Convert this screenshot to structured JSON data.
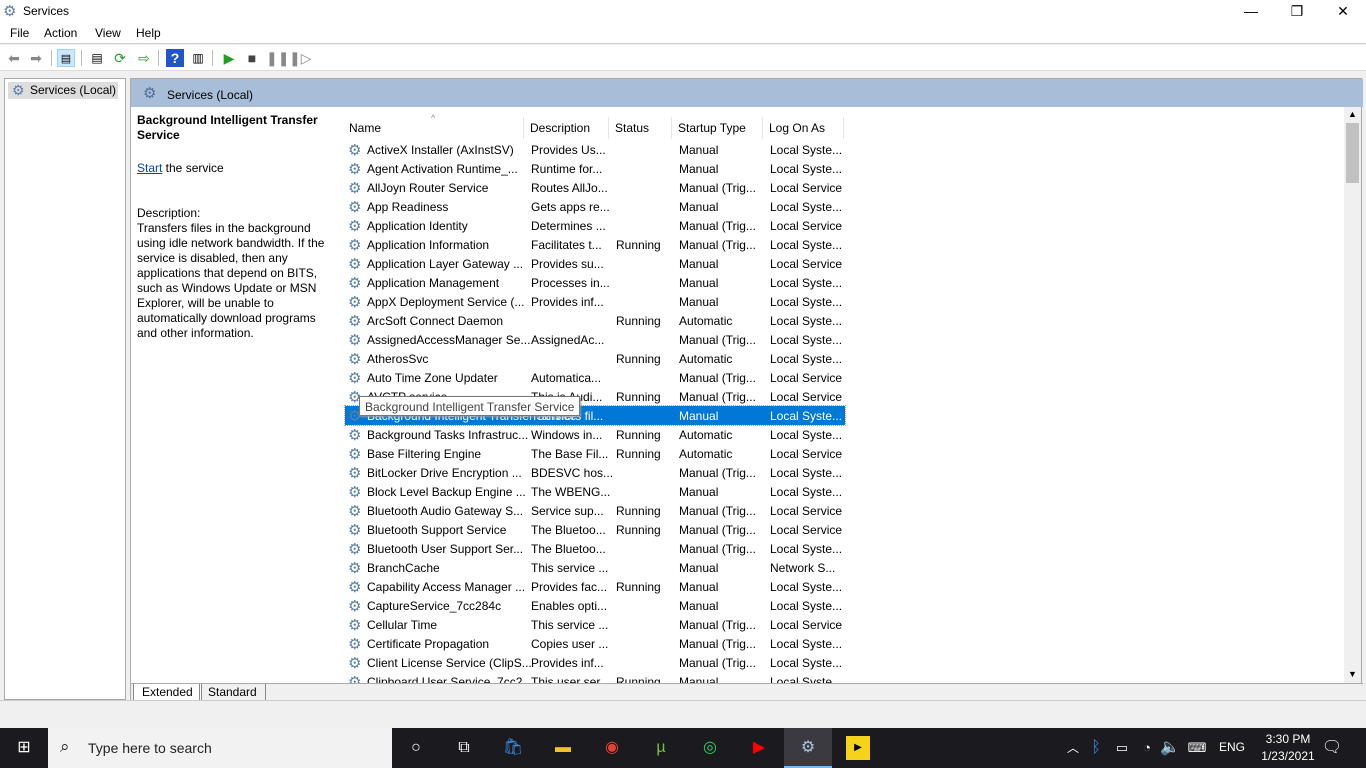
{
  "window": {
    "title": "Services",
    "minimize": "—",
    "restore": "❐",
    "close": "✕"
  },
  "menu": [
    "File",
    "Action",
    "View",
    "Help"
  ],
  "tree": {
    "item": "Services (Local)"
  },
  "header": {
    "title": "Services (Local)"
  },
  "details": {
    "service_name": "Background Intelligent Transfer Service",
    "start_link": "Start",
    "start_rest": " the service",
    "description_label": "Description:",
    "description": "Transfers files in the background using idle network bandwidth. If the service is disabled, then any applications that depend on BITS, such as Windows Update or MSN Explorer, will be unable to automatically download programs and other information."
  },
  "columns": [
    "Name",
    "Description",
    "Status",
    "Startup Type",
    "Log On As"
  ],
  "rows": [
    [
      "ActiveX Installer (AxInstSV)",
      "Provides Us...",
      "",
      "Manual",
      "Local Syste..."
    ],
    [
      "Agent Activation Runtime_...",
      "Runtime for...",
      "",
      "Manual",
      "Local Syste..."
    ],
    [
      "AllJoyn Router Service",
      "Routes AllJo...",
      "",
      "Manual (Trig...",
      "Local Service"
    ],
    [
      "App Readiness",
      "Gets apps re...",
      "",
      "Manual",
      "Local Syste..."
    ],
    [
      "Application Identity",
      "Determines ...",
      "",
      "Manual (Trig...",
      "Local Service"
    ],
    [
      "Application Information",
      "Facilitates t...",
      "Running",
      "Manual (Trig...",
      "Local Syste..."
    ],
    [
      "Application Layer Gateway ...",
      "Provides su...",
      "",
      "Manual",
      "Local Service"
    ],
    [
      "Application Management",
      "Processes in...",
      "",
      "Manual",
      "Local Syste..."
    ],
    [
      "AppX Deployment Service (...",
      "Provides inf...",
      "",
      "Manual",
      "Local Syste..."
    ],
    [
      "ArcSoft Connect Daemon",
      "",
      "Running",
      "Automatic",
      "Local Syste..."
    ],
    [
      "AssignedAccessManager Se...",
      "AssignedAc...",
      "",
      "Manual (Trig...",
      "Local Syste..."
    ],
    [
      "AtherosSvc",
      "",
      "Running",
      "Automatic",
      "Local Syste..."
    ],
    [
      "Auto Time Zone Updater",
      "Automatica...",
      "",
      "Manual (Trig...",
      "Local Service"
    ],
    [
      "AVCTP service",
      "This is Audi...",
      "Running",
      "Manual (Trig...",
      "Local Service"
    ],
    [
      "Background Intelligent Transfer Service",
      "Transfers fil...",
      "",
      "Manual",
      "Local Syste..."
    ],
    [
      "Background Tasks Infrastruc...",
      "Windows in...",
      "Running",
      "Automatic",
      "Local Syste..."
    ],
    [
      "Base Filtering Engine",
      "The Base Fil...",
      "Running",
      "Automatic",
      "Local Service"
    ],
    [
      "BitLocker Drive Encryption ...",
      "BDESVC hos...",
      "",
      "Manual (Trig...",
      "Local Syste..."
    ],
    [
      "Block Level Backup Engine ...",
      "The WBENG...",
      "",
      "Manual",
      "Local Syste..."
    ],
    [
      "Bluetooth Audio Gateway S...",
      "Service sup...",
      "Running",
      "Manual (Trig...",
      "Local Service"
    ],
    [
      "Bluetooth Support Service",
      "The Bluetoo...",
      "Running",
      "Manual (Trig...",
      "Local Service"
    ],
    [
      "Bluetooth User Support Ser...",
      "The Bluetoo...",
      "",
      "Manual (Trig...",
      "Local Syste..."
    ],
    [
      "BranchCache",
      "This service ...",
      "",
      "Manual",
      "Network S..."
    ],
    [
      "Capability Access Manager ...",
      "Provides fac...",
      "Running",
      "Manual",
      "Local Syste..."
    ],
    [
      "CaptureService_7cc284c",
      "Enables opti...",
      "",
      "Manual",
      "Local Syste..."
    ],
    [
      "Cellular Time",
      "This service ...",
      "",
      "Manual (Trig...",
      "Local Service"
    ],
    [
      "Certificate Propagation",
      "Copies user ...",
      "",
      "Manual (Trig...",
      "Local Syste..."
    ],
    [
      "Client License Service (ClipS...",
      "Provides inf...",
      "",
      "Manual (Trig...",
      "Local Syste..."
    ],
    [
      "Clipboard User Service_7cc2...",
      "This user ser...",
      "Running",
      "Manual",
      "Local Syste..."
    ]
  ],
  "selected_index": 14,
  "tooltip": "Background Intelligent Transfer Service",
  "tabs": [
    "Extended",
    "Standard"
  ],
  "taskbar": {
    "search_placeholder": "Type here to search",
    "language": "ENG",
    "time": "3:30 PM",
    "date": "1/23/2021"
  },
  "colors": {
    "selection": "#0078d7",
    "header_band": "#a7bdd8",
    "taskbar": "#1b1a1f"
  }
}
